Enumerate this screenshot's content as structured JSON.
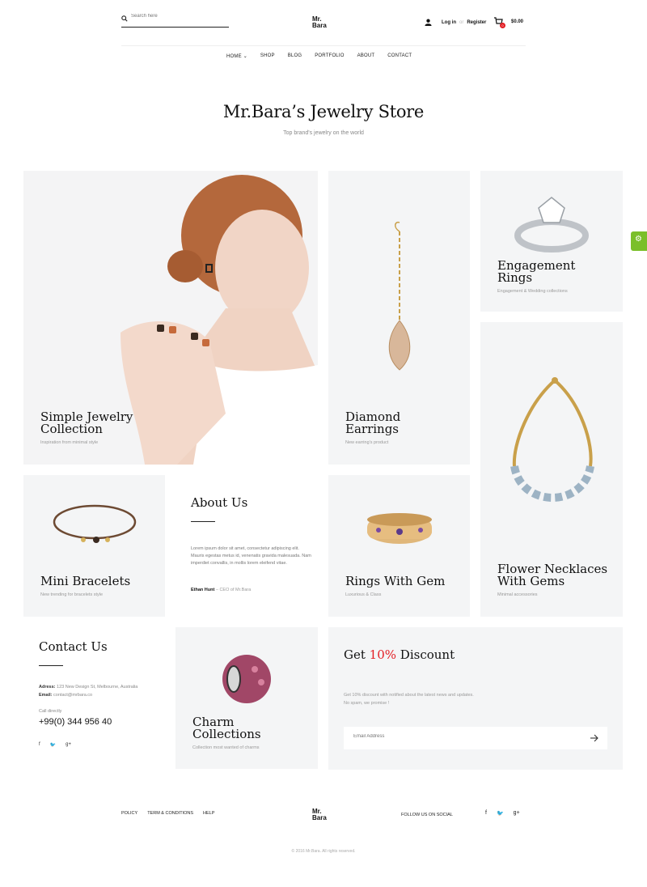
{
  "header": {
    "search_placeholder": "Search here",
    "logo_line1": "Mr.",
    "logo_line2": "Bara",
    "login": "Log in",
    "or": "or",
    "register": "Register",
    "cart_count": "0",
    "cart_total": "$0.00"
  },
  "nav": {
    "items": [
      "HOME",
      "SHOP",
      "BLOG",
      "PORTFOLIO",
      "ABOUT",
      "CONTACT"
    ]
  },
  "hero": {
    "title": "Mr.Bara’s Jewelry Store",
    "subtitle": "Top brand's jewelry on the world"
  },
  "tiles": {
    "simple": {
      "title1": "Simple Jewelry",
      "title2": "Collection",
      "sub": "Inspiration from minimal style"
    },
    "earrings": {
      "title1": "Diamond",
      "title2": "Earrings",
      "sub": "New earring's product"
    },
    "engagement": {
      "title1": "Engagement",
      "title2": "Rings",
      "sub": "Engagement & Wedding collections"
    },
    "necklaces": {
      "title1": "Flower Necklaces",
      "title2": "With Gems",
      "sub": "Minimal accessories"
    },
    "bracelets": {
      "title1": "Mini Bracelets",
      "sub": "New trending for bracelets style"
    },
    "gem_rings": {
      "title1": "Rings With Gem",
      "sub": "Luxurious & Class"
    },
    "charm": {
      "title1": "Charm",
      "title2": "Collections",
      "sub": "Collection most wanted of charms"
    }
  },
  "about": {
    "title": "About Us",
    "text": "Lorem ipsum dolor sit amet, consectetur adipiscing elit. Mauris egestas metus id, venenatis gravida malesuada. Nam imperdiet convallis, in mollis lorem eleifend vitae.",
    "author": "Ethan Hunt",
    "author_role": "– CEO of Mr.Bara"
  },
  "contact": {
    "title": "Contact Us",
    "address_label": "Adress:",
    "address": "123 New Design St, Melbourne, Australia",
    "email_label": "Email:",
    "email": "contact@mrbara.co",
    "call_label": "Call directly",
    "phone": "+99(0) 344 956 40"
  },
  "discount": {
    "title_pre": "Get",
    "title_accent": "10%",
    "title_post": "Discount",
    "text1": "Get 10% discount with notified about the latest news and updates.",
    "text2": "No spam, we promise !",
    "email_placeholder": "Email Address"
  },
  "footer": {
    "links": [
      "POLICY",
      "TERM & CONDITIONS",
      "HELP"
    ],
    "logo_line1": "Mr.",
    "logo_line2": "Bara",
    "follow": "FOLLOW US ON SOCIAL",
    "copyright": "© 2016 Mr.Bara. All rights reserved."
  },
  "colors": {
    "accent": "#e31e24",
    "tile_bg": "#f4f5f6",
    "side_tab": "#7bbf2a"
  },
  "icons": [
    "search-icon",
    "user-icon",
    "cart-icon",
    "gear-icon",
    "facebook-icon",
    "twitter-icon",
    "google-plus-icon",
    "arrow-right-icon",
    "chevron-down-icon"
  ]
}
